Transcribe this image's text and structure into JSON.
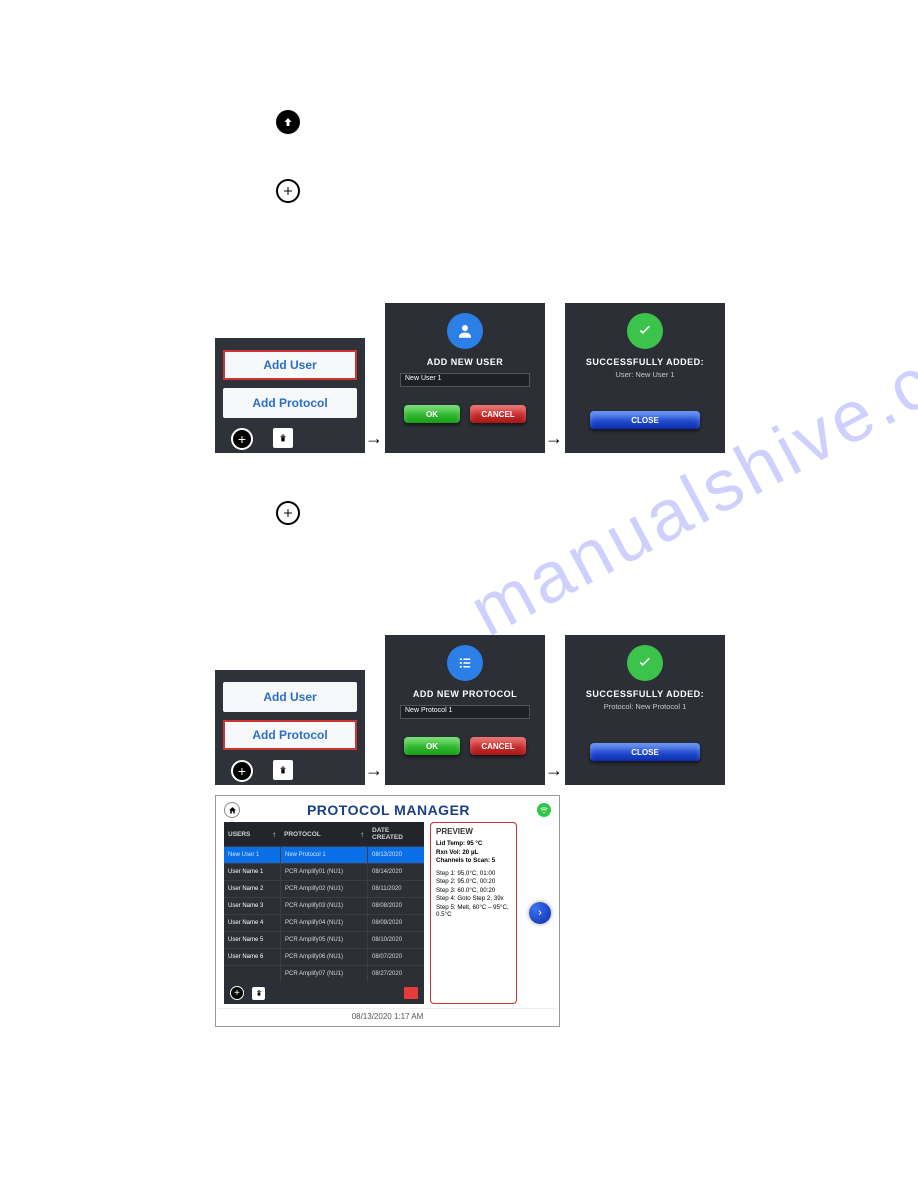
{
  "menu": {
    "add_user": "Add User",
    "add_protocol": "Add Protocol"
  },
  "add_user_dialog": {
    "title": "ADD NEW USER",
    "input": "New User 1",
    "ok": "OK",
    "cancel": "CANCEL"
  },
  "add_user_success": {
    "title": "SUCCESSFULLY ADDED:",
    "sub": "User: New User 1",
    "close": "CLOSE"
  },
  "add_protocol_dialog": {
    "title": "ADD NEW PROTOCOL",
    "input": "New Protocol 1",
    "ok": "OK",
    "cancel": "CANCEL"
  },
  "add_protocol_success": {
    "title": "SUCCESSFULLY ADDED:",
    "sub": "Protocol: New Protocol 1",
    "close": "CLOSE"
  },
  "watermark": "manualshive.com",
  "pm": {
    "title": "PROTOCOL MANAGER",
    "cols": {
      "users": "USERS",
      "protocol": "PROTOCOL",
      "date": "DATE CREATED"
    },
    "rows": [
      {
        "u": "New User 1",
        "p": "New Protocol 1",
        "d": "08/13/2020",
        "sel": true
      },
      {
        "u": "User Name 1",
        "p": "PCR Amplify01 (NU1)",
        "d": "08/14/2020"
      },
      {
        "u": "User Name 2",
        "p": "PCR Amplify02 (NU1)",
        "d": "08/11/2020"
      },
      {
        "u": "User Name 3",
        "p": "PCR Amplify03 (NU1)",
        "d": "08/08/2020"
      },
      {
        "u": "User Name 4",
        "p": "PCR Amplify04 (NU1)",
        "d": "08/09/2020"
      },
      {
        "u": "User Name 5",
        "p": "PCR Amplify05 (NU1)",
        "d": "08/10/2020"
      },
      {
        "u": "User Name 6",
        "p": "PCR Amplify06 (NU1)",
        "d": "08/07/2020"
      },
      {
        "u": "",
        "p": "PCR Amplify07 (NU1)",
        "d": "08/27/2020"
      }
    ],
    "preview": {
      "title": "PREVIEW",
      "lid": "Lid Temp: 95 °C",
      "rxn": "Rxn Vol: 20 µL",
      "chan": "Channels to Scan: 5",
      "s1": "Step 1: 95.0°C, 01:00",
      "s2": "Step 2: 95.0°C, 00:20",
      "s3": "Step 3: 60.0°C, 00:20",
      "s4": "Step 4: Goto Step 2, 39x",
      "s5": "Step 5: Melt, 60°C – 95°C, 0.5°C"
    },
    "time": "08/13/2020 1:17 AM"
  }
}
